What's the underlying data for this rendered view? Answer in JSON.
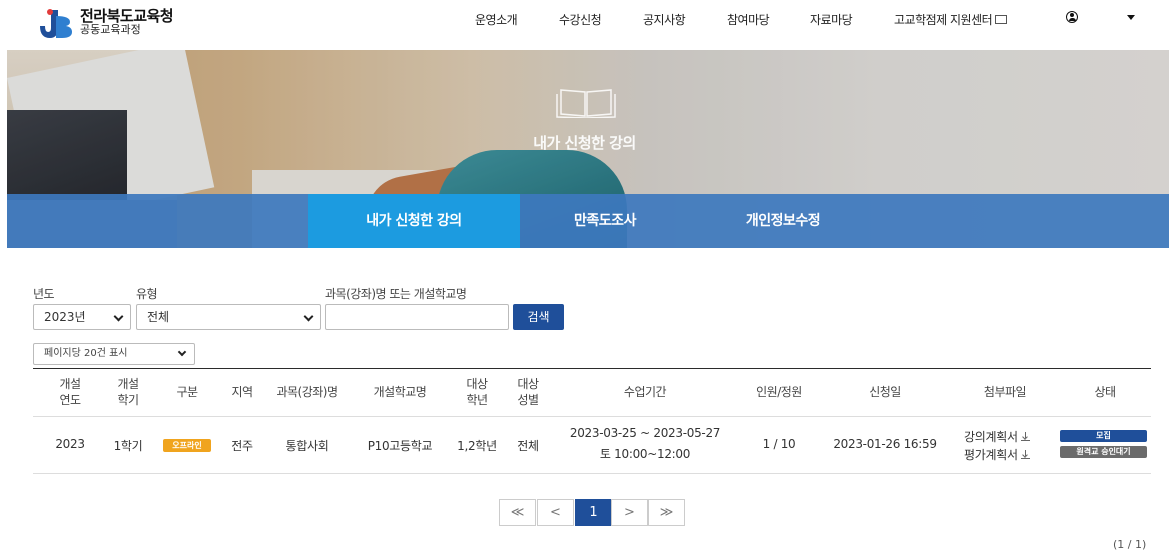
{
  "brand": {
    "title": "전라북도교육청",
    "subtitle": "공동교육과정"
  },
  "nav": {
    "items": [
      "운영소개",
      "수강신청",
      "공지사항",
      "참여마당",
      "자료마당",
      "고교학점제 지원센터"
    ]
  },
  "hero": {
    "title": "내가 신청한 강의"
  },
  "tabs": [
    "내가 신청한 강의",
    "만족도조사",
    "개인정보수정"
  ],
  "filters": {
    "year_label": "년도",
    "year_value": "2023년",
    "type_label": "유형",
    "type_value": "전체",
    "keyword_label": "과목(강좌)명 또는 개설학교명",
    "keyword_value": "",
    "search_button": "검색",
    "per_page": "페이지당 20건 표시"
  },
  "table": {
    "headers": {
      "year": "개설\n연도",
      "term": "개설\n학기",
      "kind": "구분",
      "region": "지역",
      "course": "과목(강좌)명",
      "school": "개설학교명",
      "grade": "대상\n학년",
      "gender": "대상\n성별",
      "period": "수업기간",
      "capacity": "인원/정원",
      "applied": "신청일",
      "files": "첨부파일",
      "status": "상태"
    },
    "rows": [
      {
        "year": "2023",
        "term": "1학기",
        "kind": "오프라인",
        "region": "전주",
        "course": "통합사회",
        "school": "P10고등학교",
        "grade": "1,2학년",
        "gender": "전체",
        "period_dates": "2023-03-25 ~ 2023-05-27",
        "period_time": "토 10:00~12:00",
        "capacity": "1 / 10",
        "applied": "2023-01-26 16:59",
        "file1": "강의계획서",
        "file2": "평가계획서",
        "status1": "모집",
        "status2": "원격교 승인대기"
      }
    ]
  },
  "pagination": {
    "first": "≪",
    "prev": "<",
    "current": "1",
    "next": ">",
    "last": "≫",
    "count": "(1 / 1)"
  },
  "colors": {
    "primary": "#1f4f9a",
    "tab_active": "#1c9be0",
    "tab_bar": "#3d78be",
    "offline_badge": "#f0a41e"
  }
}
